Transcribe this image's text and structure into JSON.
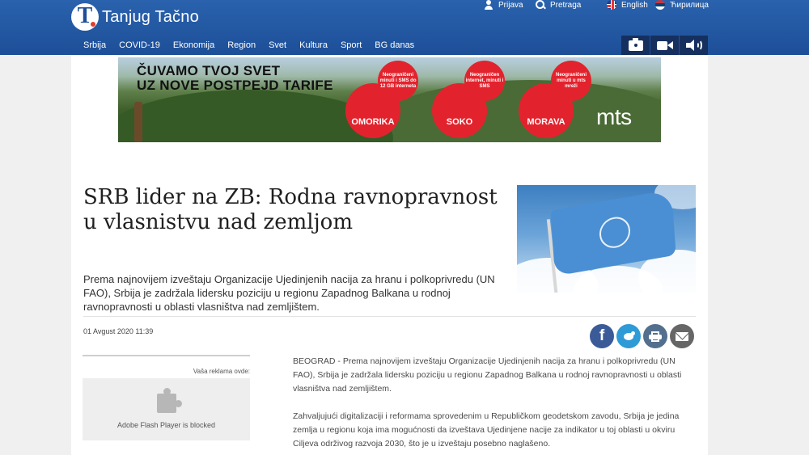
{
  "header": {
    "logo_letter": "T",
    "logo_text": "Tanjug Tačno",
    "links": {
      "login": "Prijava",
      "search": "Pretraga",
      "english": "English",
      "cyrillic": "Ћирилица"
    }
  },
  "nav": {
    "items": [
      "Srbija",
      "COVID-19",
      "Ekonomija",
      "Region",
      "Svet",
      "Kultura",
      "Sport",
      "BG danas"
    ]
  },
  "banner": {
    "headline_line1": "ČUVAMO TVOJ SVET",
    "headline_line2": "UZ NOVE POSTPEJD TARIFE",
    "offers": [
      {
        "name": "OMORIKA",
        "details": "Neograničeni minuti i SMS do 12 GB interneta"
      },
      {
        "name": "SOKO",
        "details": "Neograničen internet, minuti i SMS"
      },
      {
        "name": "MORAVA",
        "details": "Neograničeni minuti u mts mreži"
      }
    ],
    "brand": "mts",
    "colors": {
      "disc": "#e2232d"
    }
  },
  "article": {
    "title": "SRB lider na ZB: Rodna ravnopravnost u vlasnistvu nad zemljom",
    "lead": "Prema najnovijem izveštaju Organizacije Ujedinjenih nacija za hranu i polkoprivredu (UN FAO), Srbija je zadržala lidersku poziciju u regionu Zapadnog Balkana u rodnoj ravnopravnosti u oblasti vlasništva nad zemljištem.",
    "date": "01 Avgust 2020 11:39",
    "paragraphs": [
      "BEOGRAD - Prema najnovijem izveštaju Organizacije Ujedinjenih nacija za hranu i polkoprivredu (UN FAO), Srbija je zadržala lidersku poziciju u regionu Zapadnog Balkana u rodnoj ravnopravnosti u oblasti vlasništva nad zemljištem.",
      "Zahvaljujući digitalizaciji i reformama sprovedenim u Republičkom geodetskom zavodu, Srbija je jedina zemlja u regionu koja ima mogućnosti da izveštava Ujedinjene nacije za indikator u toj oblasti u okviru Ciljeva održivog razvoja 2030, što je u izveštaju posebno naglašeno."
    ],
    "share": {
      "facebook_glyph": "f"
    }
  },
  "ad_slot": {
    "label": "Vaša reklama ovde:",
    "message": "Adobe Flash Player is blocked"
  }
}
